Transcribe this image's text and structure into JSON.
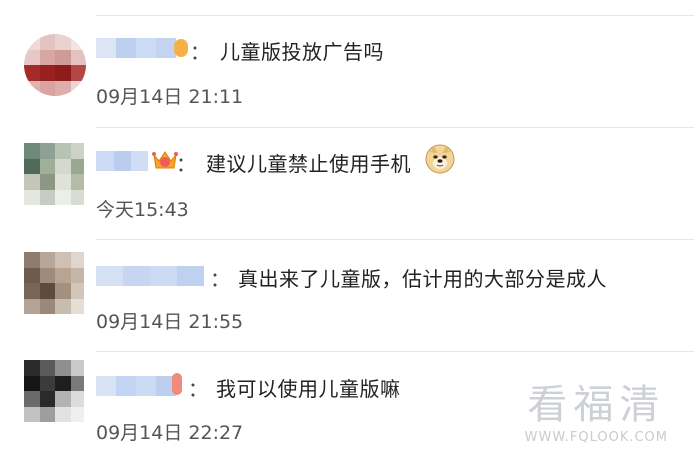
{
  "comments": [
    {
      "colon": "：",
      "text": "儿童版投放广告吗",
      "time": "09月14日 21:11"
    },
    {
      "colon": "：",
      "text": "建议儿童禁止使用手机",
      "time": "今天15:43",
      "emoji": "doge-emoji"
    },
    {
      "colon": "：",
      "text": "真出来了儿童版，估计用的大部分是成人",
      "time": "09月14日 21:55"
    },
    {
      "colon": "：",
      "text": "我可以使用儿童版嘛",
      "time": "09月14日 22:27"
    }
  ],
  "watermark": {
    "title": "看福清",
    "url": "WWW.FQLOOK.COM"
  },
  "colors": {
    "username_blur": "#b9cdee",
    "divider": "#e6e6e6",
    "time_text": "#555555"
  }
}
